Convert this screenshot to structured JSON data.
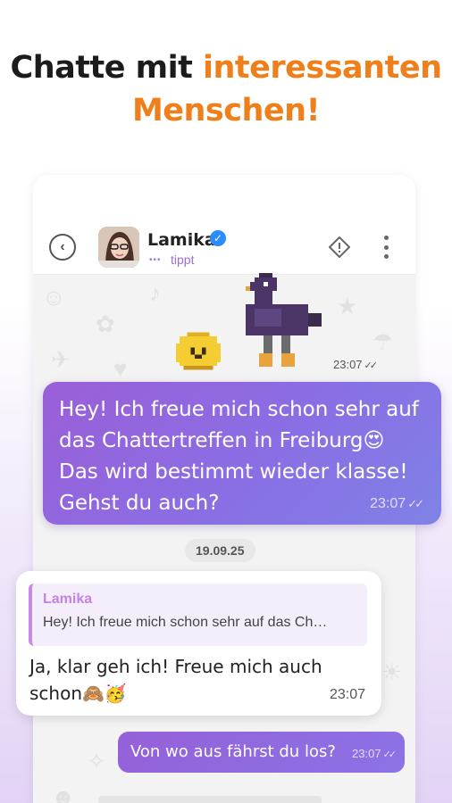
{
  "headline": {
    "part1": "Chatte mit ",
    "part2": "interessanten",
    "part3": "Menschen!"
  },
  "header": {
    "contact_name": "Lamika",
    "status_dots": "•••",
    "status": "tippt",
    "icons": {
      "back": "back-arrow-icon",
      "verified": "verified-badge-icon",
      "report": "report-warning-icon",
      "menu": "more-vertical-icon"
    }
  },
  "messages": [
    {
      "type": "sticker",
      "direction": "outgoing",
      "time": "23:07",
      "ticks": "✓✓"
    },
    {
      "type": "text",
      "direction": "outgoing",
      "text": "Hey! Ich freue mich schon sehr auf das Chattertreffen in Freiburg😍 Das wird bestimmt wieder klasse! Gehst du auch?",
      "time": "23:07",
      "ticks": "✓✓"
    },
    {
      "type": "text",
      "direction": "incoming",
      "quote_author": "Lamika",
      "quote_text": "Hey! Ich freue mich schon sehr auf das Ch…",
      "text": "Ja, klar geh ich! Freue mich auch schon🙈🥳",
      "time": "23:07"
    },
    {
      "type": "text",
      "direction": "outgoing",
      "text": "Von wo aus fährst du los?",
      "time": "23:07",
      "ticks": "✓✓"
    }
  ],
  "date_separator": "19.09.25",
  "colors": {
    "accent_orange": "#ee7f1a",
    "bubble_purple": "#9a5fd8",
    "bubble_blue": "#7f82e6",
    "quote_pink": "#c283e4",
    "verified_blue": "#2b8cff"
  }
}
